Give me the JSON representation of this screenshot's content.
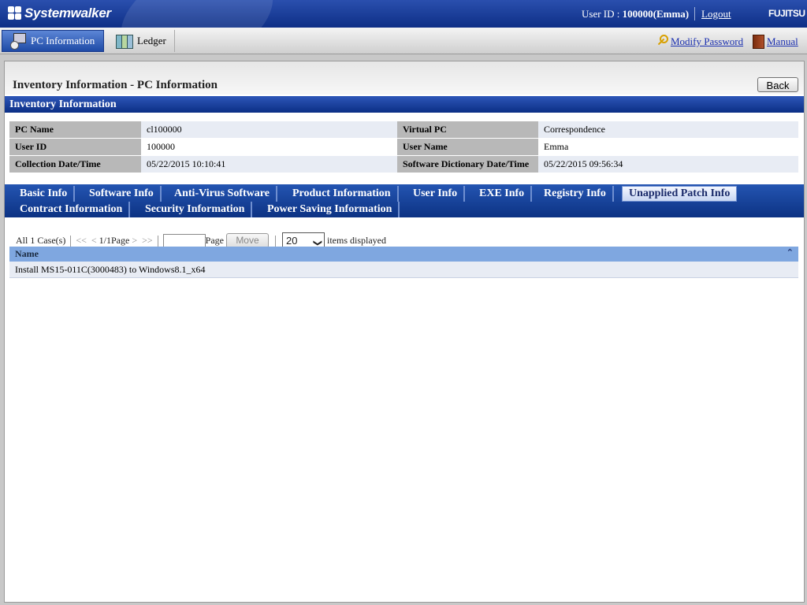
{
  "header": {
    "logo": "Systemwalker",
    "user_id_label": "User ID : ",
    "user_id_value": "100000(Emma)",
    "logout": "Logout",
    "vendor": "FUJITSU"
  },
  "nav": {
    "tabs": [
      "PC Information",
      "Ledger"
    ],
    "modify_password": "Modify Password",
    "manual": "Manual"
  },
  "page": {
    "title": "Inventory Information - PC Information",
    "back": "Back",
    "section": "Inventory Information"
  },
  "info": {
    "rows": [
      {
        "l1": "PC Name",
        "v1": "cl100000",
        "l2": "Virtual PC",
        "v2": "Correspondence"
      },
      {
        "l1": "User ID",
        "v1": "100000",
        "l2": "User Name",
        "v2": "Emma"
      },
      {
        "l1": "Collection Date/Time",
        "v1": "05/22/2015 10:10:41",
        "l2": "Software Dictionary Date/Time",
        "v2": "05/22/2015 09:56:34"
      }
    ]
  },
  "tabs": {
    "row1": [
      "Basic Info",
      "Software Info",
      "Anti-Virus Software",
      "Product Information",
      "User Info",
      "EXE Info",
      "Registry Info",
      "Unapplied Patch Info"
    ],
    "row2": [
      "Contract Information",
      "Security Information",
      "Power Saving Information"
    ],
    "active": "Unapplied Patch Info"
  },
  "pager": {
    "cases": "All 1 Case(s)",
    "first": "<<",
    "prev": "<",
    "page": "1/1Page",
    "next": ">",
    "last": ">>",
    "page_label": "Page",
    "move": "Move",
    "per_page": "20",
    "items_displayed": "items displayed"
  },
  "list": {
    "column": "Name",
    "sort_icon": "double-up-arrow",
    "rows": [
      "Install MS15-011C(3000483) to Windows8.1_x64"
    ]
  },
  "colors": {
    "header_blue": "#0e2f86",
    "tab_bar": "#0c3283",
    "list_header": "#7fa7e0"
  }
}
